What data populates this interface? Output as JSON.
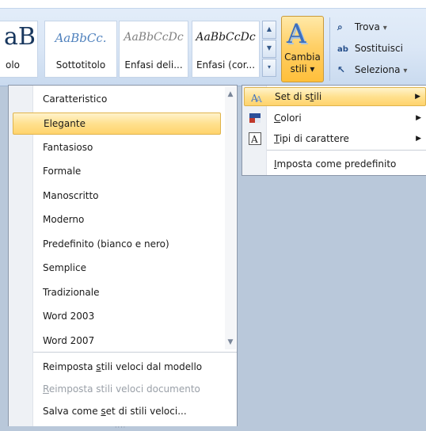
{
  "ribbon": {
    "styles": [
      {
        "sample": "aB",
        "label": "olo"
      },
      {
        "sample": "AaBbCc.",
        "label": "Sottotitolo"
      },
      {
        "sample": "AaBbCcDc",
        "label": "Enfasi deli..."
      },
      {
        "sample": "AaBbCcDc",
        "label": "Enfasi (cor..."
      }
    ],
    "change_styles": {
      "line1": "Cambia",
      "line2": "stili",
      "caret": "▾"
    },
    "editing": [
      {
        "icon": "binoculars-icon",
        "glyph": "🔍",
        "label": "Trova",
        "caret": "▾"
      },
      {
        "icon": "replace-icon",
        "glyph": "ab",
        "label": "Sostituisci",
        "caret": ""
      },
      {
        "icon": "select-cursor-icon",
        "glyph": "↖",
        "label": "Seleziona",
        "caret": "▾"
      }
    ]
  },
  "style_sets_menu": {
    "items": [
      "Caratteristico",
      "Elegante",
      "Fantasioso",
      "Formale",
      "Manoscritto",
      "Moderno",
      "Predefinito (bianco e nero)",
      "Semplice",
      "Tradizionale",
      "Word 2003",
      "Word 2007"
    ],
    "selected_index": 1,
    "bottom_items": [
      {
        "pre": "Reimposta ",
        "u": "s",
        "post": "tili veloci dal modello",
        "disabled": false
      },
      {
        "pre": "",
        "u": "R",
        "post": "eimposta stili veloci documento",
        "disabled": true
      },
      {
        "pre": "Salva come ",
        "u": "s",
        "post": "et di stili veloci...",
        "disabled": false
      }
    ],
    "grip": "····"
  },
  "change_styles_menu": {
    "items": [
      {
        "icon": "style-set-icon",
        "pre": "Set di s",
        "u": "t",
        "post": "ili",
        "has_submenu": true,
        "active": true
      },
      {
        "icon": "colors-icon",
        "pre": "",
        "u": "C",
        "post": "olori",
        "has_submenu": true,
        "active": false
      },
      {
        "icon": "fonts-icon",
        "pre": "",
        "u": "T",
        "post": "ipi di carattere",
        "has_submenu": true,
        "active": false
      },
      {
        "icon": "",
        "pre": "",
        "u": "I",
        "post": "mposta come predefinito",
        "has_submenu": false,
        "active": false
      }
    ],
    "arrow": "▶"
  }
}
